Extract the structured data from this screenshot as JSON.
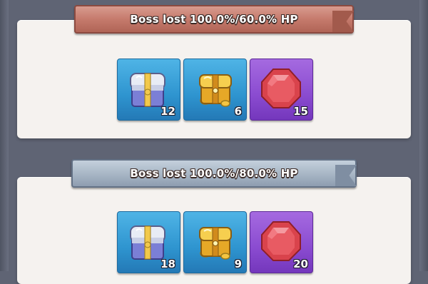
{
  "tiers": [
    {
      "header": "Boss lost 100.0%/60.0% HP",
      "ribbon_color": "#c57a6c",
      "rewards": [
        {
          "icon": "silver-chest-icon",
          "count": "12"
        },
        {
          "icon": "gold-chest-icon",
          "count": "6"
        },
        {
          "icon": "red-gem-icon",
          "count": "15"
        }
      ]
    },
    {
      "header": "Boss lost 100.0%/80.0% HP",
      "ribbon_color": "#a9b7c6",
      "rewards": [
        {
          "icon": "silver-chest-icon",
          "count": "18"
        },
        {
          "icon": "gold-chest-icon",
          "count": "9"
        },
        {
          "icon": "red-gem-icon",
          "count": "20"
        }
      ]
    }
  ]
}
